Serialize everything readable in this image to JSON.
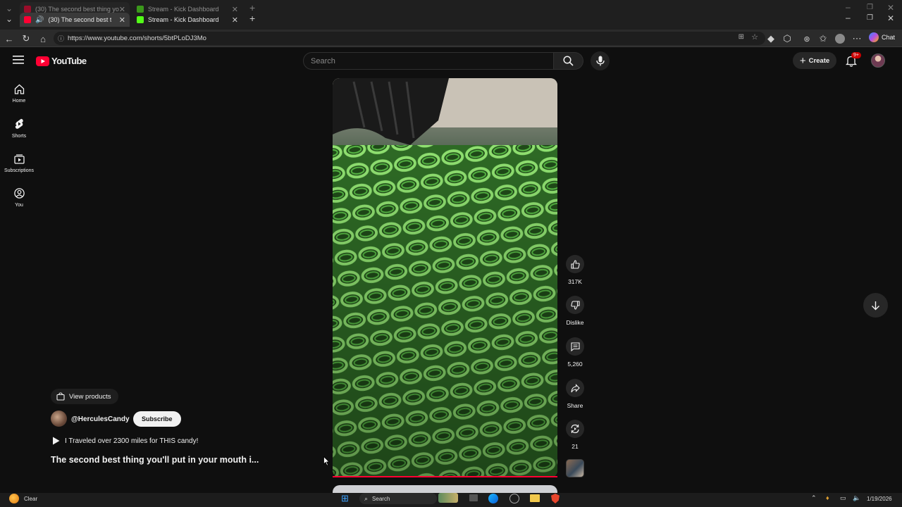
{
  "browser": {
    "tabs": [
      {
        "title": "(30) The second best thing yo",
        "active": true
      },
      {
        "title": "Stream - Kick Dashboard",
        "active": false
      }
    ],
    "url": "https://www.youtube.com/shorts/5btPLoDJ3Mo",
    "chat_label": "Chat"
  },
  "youtube": {
    "logo_text": "YouTube",
    "search_placeholder": "Search",
    "create_label": "Create",
    "notification_count": "9+",
    "sidebar": [
      {
        "label": "Home",
        "icon": "home-icon"
      },
      {
        "label": "Shorts",
        "icon": "shorts-icon"
      },
      {
        "label": "Subscriptions",
        "icon": "subscriptions-icon"
      },
      {
        "label": "You",
        "icon": "you-icon"
      }
    ],
    "short": {
      "view_products": "View products",
      "channel": "@HerculesCandy",
      "subscribe": "Subscribe",
      "linked_video": "I Traveled over 2300 miles for THIS candy!",
      "title": "The second best thing you'll put in your mouth i..."
    },
    "actions": {
      "likes": "317K",
      "dislike": "Dislike",
      "comments": "5,260",
      "share": "Share",
      "remix": "21"
    }
  },
  "taskbar": {
    "weather": "Clear",
    "search": "Search",
    "date": "1/19/2026"
  },
  "colors": {
    "youtube_red": "#ff0033",
    "background": "#0f0f0f",
    "candy_green": "#5fbf4a"
  }
}
